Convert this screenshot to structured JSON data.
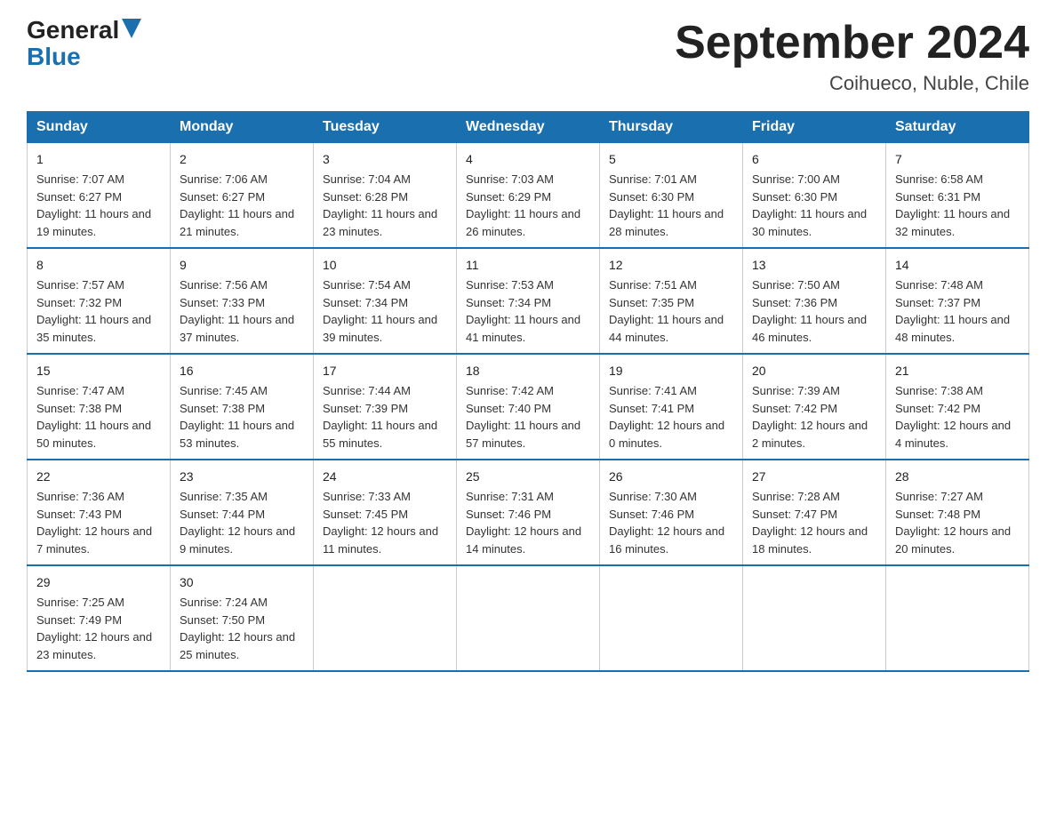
{
  "header": {
    "logo_general": "General",
    "logo_blue": "Blue",
    "month_title": "September 2024",
    "location": "Coihueco, Nuble, Chile"
  },
  "days_of_week": [
    "Sunday",
    "Monday",
    "Tuesday",
    "Wednesday",
    "Thursday",
    "Friday",
    "Saturday"
  ],
  "weeks": [
    [
      {
        "day": "1",
        "sunrise": "7:07 AM",
        "sunset": "6:27 PM",
        "daylight": "11 hours and 19 minutes."
      },
      {
        "day": "2",
        "sunrise": "7:06 AM",
        "sunset": "6:27 PM",
        "daylight": "11 hours and 21 minutes."
      },
      {
        "day": "3",
        "sunrise": "7:04 AM",
        "sunset": "6:28 PM",
        "daylight": "11 hours and 23 minutes."
      },
      {
        "day": "4",
        "sunrise": "7:03 AM",
        "sunset": "6:29 PM",
        "daylight": "11 hours and 26 minutes."
      },
      {
        "day": "5",
        "sunrise": "7:01 AM",
        "sunset": "6:30 PM",
        "daylight": "11 hours and 28 minutes."
      },
      {
        "day": "6",
        "sunrise": "7:00 AM",
        "sunset": "6:30 PM",
        "daylight": "11 hours and 30 minutes."
      },
      {
        "day": "7",
        "sunrise": "6:58 AM",
        "sunset": "6:31 PM",
        "daylight": "11 hours and 32 minutes."
      }
    ],
    [
      {
        "day": "8",
        "sunrise": "7:57 AM",
        "sunset": "7:32 PM",
        "daylight": "11 hours and 35 minutes."
      },
      {
        "day": "9",
        "sunrise": "7:56 AM",
        "sunset": "7:33 PM",
        "daylight": "11 hours and 37 minutes."
      },
      {
        "day": "10",
        "sunrise": "7:54 AM",
        "sunset": "7:34 PM",
        "daylight": "11 hours and 39 minutes."
      },
      {
        "day": "11",
        "sunrise": "7:53 AM",
        "sunset": "7:34 PM",
        "daylight": "11 hours and 41 minutes."
      },
      {
        "day": "12",
        "sunrise": "7:51 AM",
        "sunset": "7:35 PM",
        "daylight": "11 hours and 44 minutes."
      },
      {
        "day": "13",
        "sunrise": "7:50 AM",
        "sunset": "7:36 PM",
        "daylight": "11 hours and 46 minutes."
      },
      {
        "day": "14",
        "sunrise": "7:48 AM",
        "sunset": "7:37 PM",
        "daylight": "11 hours and 48 minutes."
      }
    ],
    [
      {
        "day": "15",
        "sunrise": "7:47 AM",
        "sunset": "7:38 PM",
        "daylight": "11 hours and 50 minutes."
      },
      {
        "day": "16",
        "sunrise": "7:45 AM",
        "sunset": "7:38 PM",
        "daylight": "11 hours and 53 minutes."
      },
      {
        "day": "17",
        "sunrise": "7:44 AM",
        "sunset": "7:39 PM",
        "daylight": "11 hours and 55 minutes."
      },
      {
        "day": "18",
        "sunrise": "7:42 AM",
        "sunset": "7:40 PM",
        "daylight": "11 hours and 57 minutes."
      },
      {
        "day": "19",
        "sunrise": "7:41 AM",
        "sunset": "7:41 PM",
        "daylight": "12 hours and 0 minutes."
      },
      {
        "day": "20",
        "sunrise": "7:39 AM",
        "sunset": "7:42 PM",
        "daylight": "12 hours and 2 minutes."
      },
      {
        "day": "21",
        "sunrise": "7:38 AM",
        "sunset": "7:42 PM",
        "daylight": "12 hours and 4 minutes."
      }
    ],
    [
      {
        "day": "22",
        "sunrise": "7:36 AM",
        "sunset": "7:43 PM",
        "daylight": "12 hours and 7 minutes."
      },
      {
        "day": "23",
        "sunrise": "7:35 AM",
        "sunset": "7:44 PM",
        "daylight": "12 hours and 9 minutes."
      },
      {
        "day": "24",
        "sunrise": "7:33 AM",
        "sunset": "7:45 PM",
        "daylight": "12 hours and 11 minutes."
      },
      {
        "day": "25",
        "sunrise": "7:31 AM",
        "sunset": "7:46 PM",
        "daylight": "12 hours and 14 minutes."
      },
      {
        "day": "26",
        "sunrise": "7:30 AM",
        "sunset": "7:46 PM",
        "daylight": "12 hours and 16 minutes."
      },
      {
        "day": "27",
        "sunrise": "7:28 AM",
        "sunset": "7:47 PM",
        "daylight": "12 hours and 18 minutes."
      },
      {
        "day": "28",
        "sunrise": "7:27 AM",
        "sunset": "7:48 PM",
        "daylight": "12 hours and 20 minutes."
      }
    ],
    [
      {
        "day": "29",
        "sunrise": "7:25 AM",
        "sunset": "7:49 PM",
        "daylight": "12 hours and 23 minutes."
      },
      {
        "day": "30",
        "sunrise": "7:24 AM",
        "sunset": "7:50 PM",
        "daylight": "12 hours and 25 minutes."
      },
      null,
      null,
      null,
      null,
      null
    ]
  ]
}
